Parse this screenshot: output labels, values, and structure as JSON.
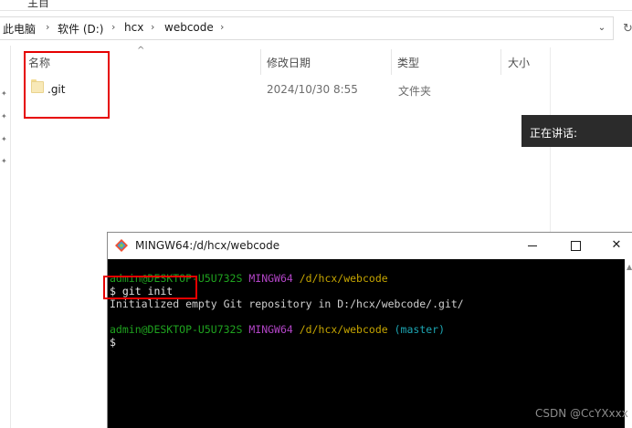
{
  "explorer": {
    "top_partial": "主目",
    "breadcrumbs": [
      "此电脑",
      "软件 (D:)",
      "hcx",
      "webcode"
    ],
    "columns": [
      "名称",
      "修改日期",
      "类型",
      "大小"
    ],
    "files": [
      {
        "name": ".git",
        "modified": "2024/10/30 8:55",
        "type": "文件夹",
        "size": ""
      }
    ]
  },
  "overlay": {
    "speaking_label": "正在讲话:"
  },
  "terminal": {
    "title": "MINGW64:/d/hcx/webcode",
    "prompt1": {
      "user": "admin@DESKTOP-U5U732S",
      "shell": "MINGW64",
      "path": "/d/hcx/webcode"
    },
    "command": "$ git init",
    "output": "Initialized empty Git repository in D:/hcx/webcode/.git/",
    "prompt2": {
      "user": "admin@DESKTOP-U5U732S",
      "shell": "MINGW64",
      "path": "/d/hcx/webcode",
      "branch": "(master)"
    },
    "cursor_line": "$"
  },
  "watermark": "CSDN @CcYXxxx",
  "colors": {
    "highlight_box": "#e60000",
    "prompt_user": "#1fa31f",
    "prompt_shell": "#b244c6",
    "prompt_path": "#c5a500",
    "prompt_branch": "#1da6b3"
  }
}
